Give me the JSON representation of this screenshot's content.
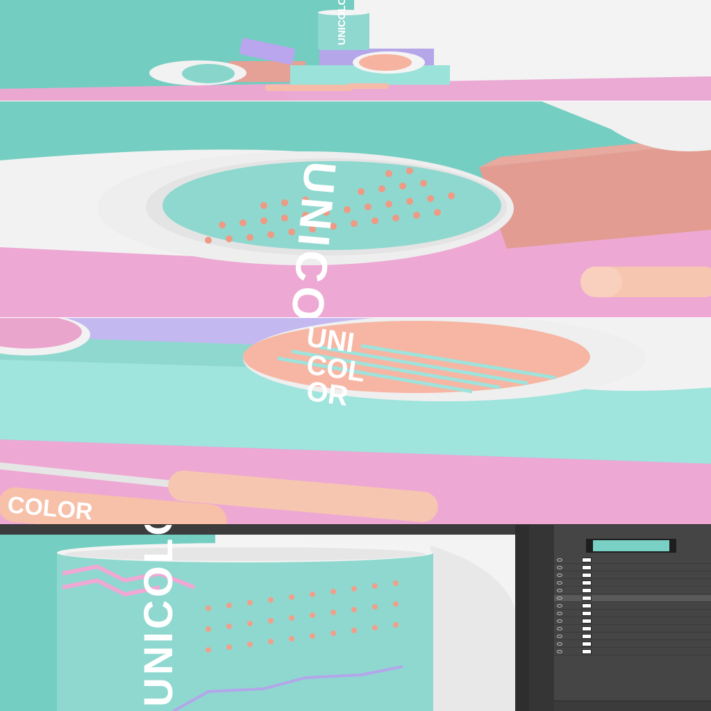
{
  "brand": {
    "word": "UNICOLOR",
    "lid_pink_lines": [
      "UNI",
      "COL",
      "OR"
    ],
    "side_text_mid": "UNICO",
    "side_text_tube": "COLOR"
  },
  "colors": {
    "teal": "#79d1c6",
    "mint": "#98e3dc",
    "pink": "#eda9d3",
    "peach": "#f6b6a3",
    "salmon": "#e39d92",
    "lavender": "#b3a7ec",
    "white": "#f1f1f1"
  },
  "photoshop": {
    "tab_labels": [
      "",
      ""
    ],
    "layer_rows": [
      {
        "name": "",
        "highlight": false
      },
      {
        "name": "",
        "highlight": false
      },
      {
        "name": "",
        "highlight": false
      },
      {
        "name": "",
        "highlight": false
      },
      {
        "name": "",
        "highlight": false
      },
      {
        "name": "",
        "highlight": true
      },
      {
        "name": "",
        "highlight": false
      },
      {
        "name": "",
        "highlight": false
      },
      {
        "name": "",
        "highlight": false
      },
      {
        "name": "",
        "highlight": false
      },
      {
        "name": "",
        "highlight": false
      },
      {
        "name": "",
        "highlight": false
      },
      {
        "name": "",
        "highlight": false
      }
    ]
  }
}
